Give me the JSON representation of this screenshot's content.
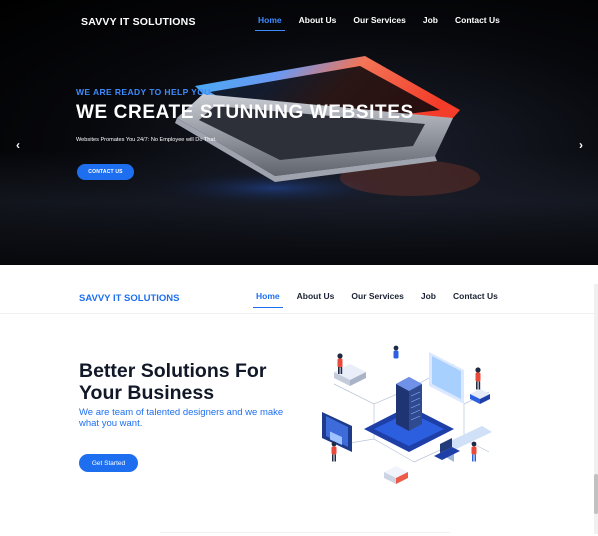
{
  "hero": {
    "brand": "SAVVY IT SOLUTIONS",
    "nav": [
      {
        "label": "Home",
        "active": true
      },
      {
        "label": "About Us",
        "active": false
      },
      {
        "label": "Our Services",
        "active": false
      },
      {
        "label": "Job",
        "active": false
      },
      {
        "label": "Contact Us",
        "active": false
      }
    ],
    "kicker": "WE ARE READY TO HELP YOU",
    "title": "WE CREATE STUNNING WEBSITES",
    "subtitle": "Websites Promates You 24/7: No Employee will Do That.",
    "cta": "CONTACT US",
    "prev_arrow": "‹",
    "next_arrow": "›"
  },
  "section2": {
    "brand": "SAVVY IT SOLUTIONS",
    "nav": [
      {
        "label": "Home",
        "active": true
      },
      {
        "label": "About Us",
        "active": false
      },
      {
        "label": "Our Services",
        "active": false
      },
      {
        "label": "Job",
        "active": false
      },
      {
        "label": "Contact Us",
        "active": false
      }
    ],
    "title": "Better Solutions For Your Business",
    "subtitle": "We are team of talented designers and we make what you want.",
    "cta": "Get Started"
  },
  "colors": {
    "accent": "#1e6fef",
    "accent_light": "#3e8cff",
    "heading": "#111827"
  },
  "icons": {
    "prev": "chevron-left-icon",
    "next": "chevron-right-icon"
  }
}
